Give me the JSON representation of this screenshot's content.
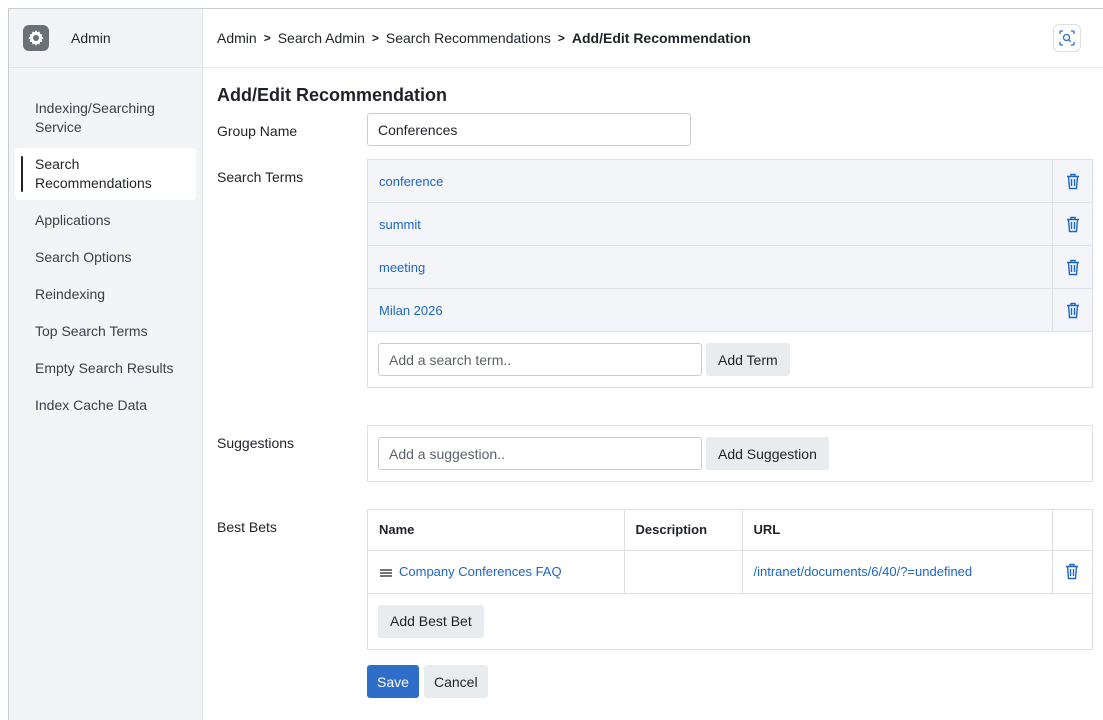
{
  "app": {
    "title": "Admin",
    "logo_icon": "gear-icon"
  },
  "sidebar": {
    "items": [
      {
        "label": "Indexing/Searching Service",
        "active": false
      },
      {
        "label": "Search Recommendations",
        "active": true
      },
      {
        "label": "Applications",
        "active": false
      },
      {
        "label": "Search Options",
        "active": false
      },
      {
        "label": "Reindexing",
        "active": false
      },
      {
        "label": "Top Search Terms",
        "active": false
      },
      {
        "label": "Empty Search Results",
        "active": false
      },
      {
        "label": "Index Cache Data",
        "active": false
      }
    ]
  },
  "breadcrumb": {
    "items": [
      "Admin",
      "Search Admin",
      "Search Recommendations",
      "Add/Edit Recommendation"
    ],
    "separator": ">"
  },
  "page": {
    "title": "Add/Edit Recommendation"
  },
  "group_name": {
    "label": "Group Name",
    "value": "Conferences"
  },
  "search_terms": {
    "label": "Search Terms",
    "terms": [
      "conference",
      "summit",
      "meeting",
      "Milan 2026"
    ],
    "input_placeholder": "Add a search term..",
    "add_button": "Add Term"
  },
  "suggestions": {
    "label": "Suggestions",
    "input_placeholder": "Add a suggestion..",
    "add_button": "Add Suggestion"
  },
  "best_bets": {
    "label": "Best Bets",
    "columns": [
      "Name",
      "Description",
      "URL"
    ],
    "rows": [
      {
        "name": "Company Conferences FAQ",
        "description": "",
        "url": "/intranet/documents/6/40/?=undefined"
      }
    ],
    "add_button": "Add Best Bet"
  },
  "actions": {
    "save": "Save",
    "cancel": "Cancel"
  },
  "colors": {
    "accent": "#2f6ec8",
    "link": "#1c66c6",
    "sidebar_bg": "#f3f4f6"
  }
}
